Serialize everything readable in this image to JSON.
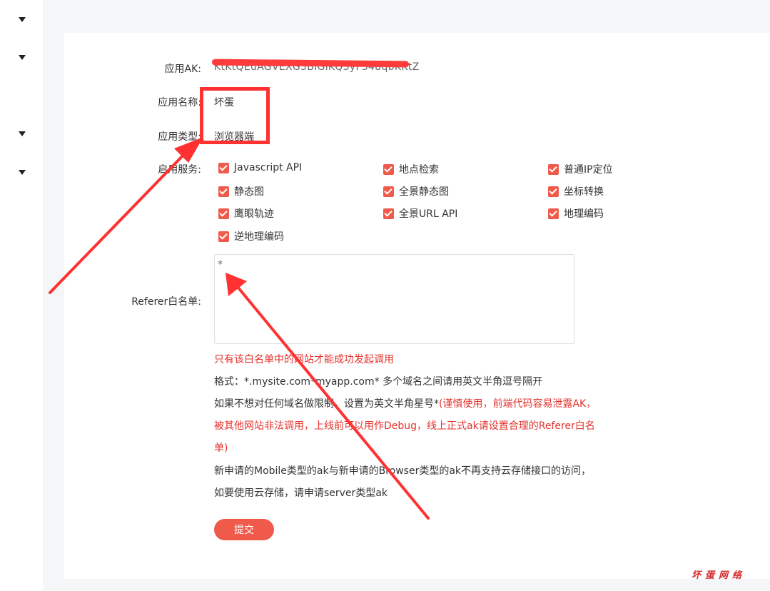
{
  "form": {
    "ak_label": "应用AK:",
    "ak_value": "KtKtQEuAGVEXG3BIGlKQ3yF348qbKKtZ",
    "name_label": "应用名称:",
    "name_value": "坏蛋",
    "type_label": "应用类型:",
    "type_value": "浏览器端",
    "services_label": "启用服务:",
    "services": [
      {
        "label": "Javascript API",
        "checked": true
      },
      {
        "label": "地点检索",
        "checked": true
      },
      {
        "label": "普通IP定位",
        "checked": true
      },
      {
        "label": "静态图",
        "checked": true
      },
      {
        "label": "全景静态图",
        "checked": true
      },
      {
        "label": "坐标转换",
        "checked": true
      },
      {
        "label": "鹰眼轨迹",
        "checked": true
      },
      {
        "label": "全景URL API",
        "checked": true
      },
      {
        "label": "地理编码",
        "checked": true
      },
      {
        "label": "逆地理编码",
        "checked": true
      }
    ],
    "referer_label": "Referer白名单:",
    "referer_value": "*",
    "notes": {
      "warning": "只有该白名单中的网站才能成功发起调用",
      "format": "格式：*.mysite.com*myapp.com* 多个域名之间请用英文半角逗号隔开",
      "no_limit_prefix": "如果不想对任何域名做限制，设置为英文半角星号*",
      "no_limit_red": "(谨慎使用，前端代码容易泄露AK，被其他网站非法调用，上线前可以用作Debug，线上正式ak请设置合理的Referer白名单)",
      "mobile": "新申请的Mobile类型的ak与新申请的Browser类型的ak不再支持云存储接口的访问，如要使用云存储，请申请server类型ak"
    },
    "submit_label": "提交"
  },
  "watermark": "坏蛋网络",
  "colors": {
    "accent": "#f05a4b",
    "annotation": "#ff3131",
    "warning_text": "#e5322d"
  }
}
